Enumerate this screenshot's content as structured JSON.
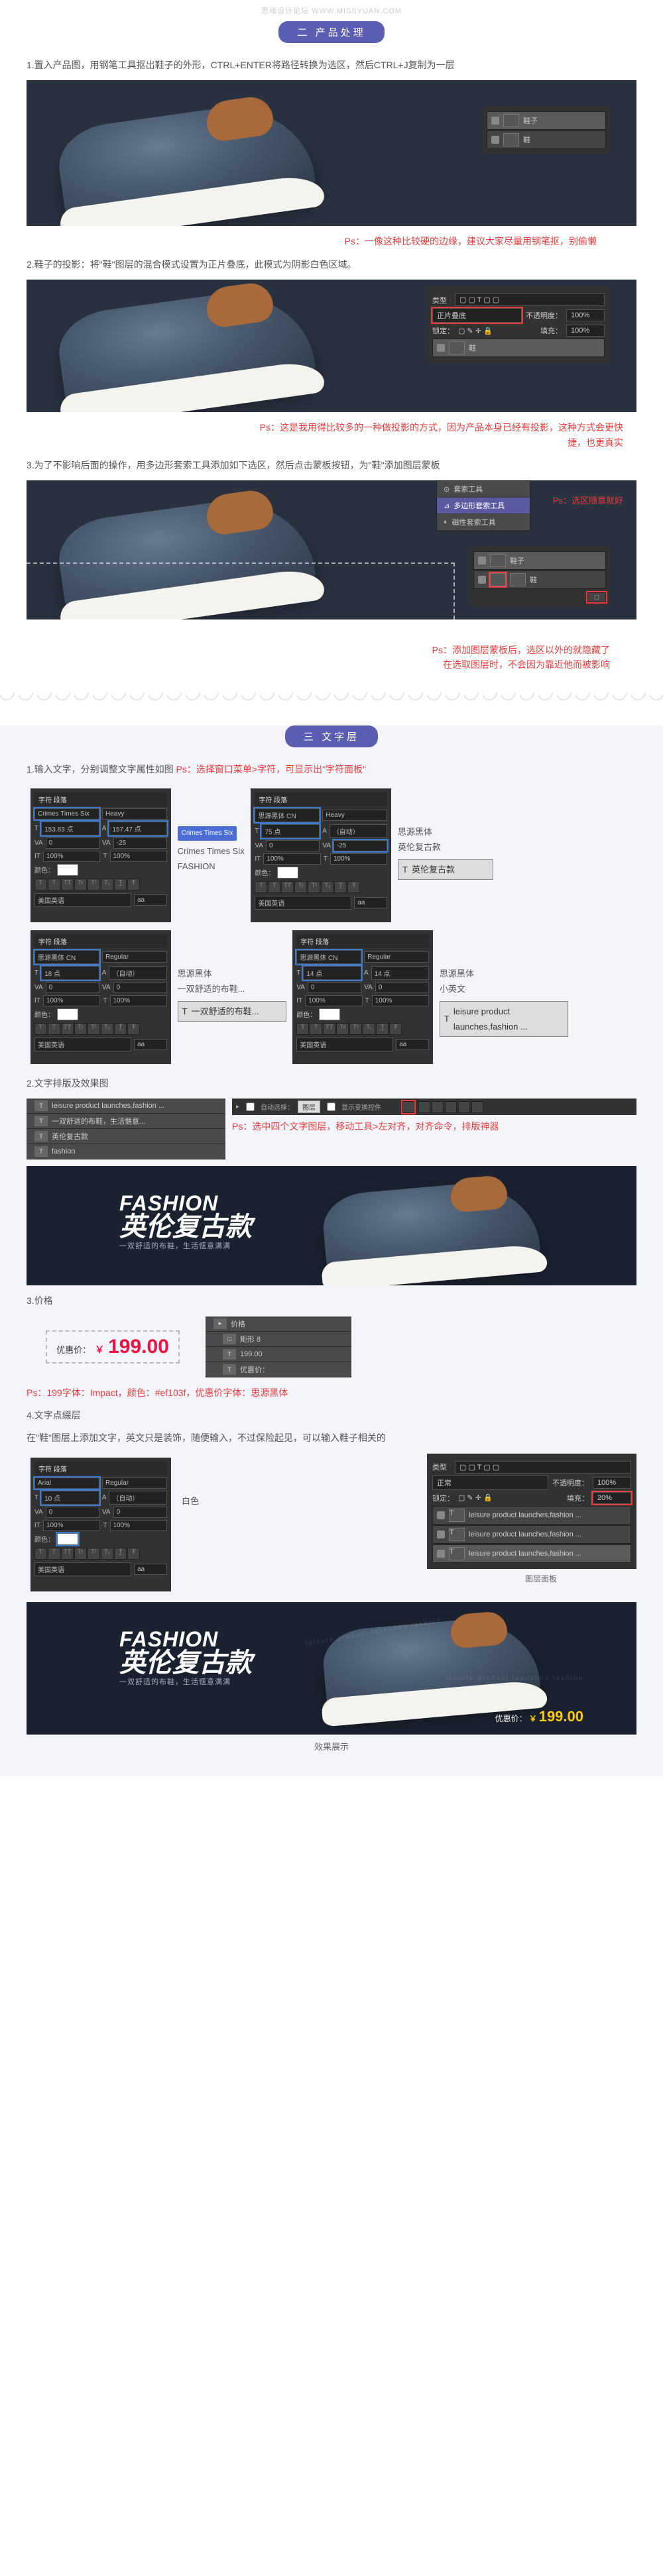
{
  "watermark": "思缘设计论坛  WWW.MISSYUAN.COM",
  "section2": {
    "title": "二 产品处理",
    "step1": "1.置入产品图，用钢笔工具抠出鞋子的外形，CTRL+ENTER将路径转换为选区，然后CTRL+J复制为一层",
    "step1_ps": "Ps：一像这种比较硬的边缘，建议大家尽量用钢笔抠，别偷懒",
    "layer_name": "鞋子",
    "step2": "2.鞋子的投影：将\"鞋\"图层的混合模式设置为正片叠底，此模式为阴影白色区域。",
    "blend": {
      "kind": "类型",
      "mode": "正片叠底",
      "opacity_label": "不透明度：",
      "opacity_val": "100%",
      "lock": "锁定：",
      "fill_label": "填充：",
      "fill_val": "100%",
      "layer": "鞋"
    },
    "step2_ps": "Ps：这是我用得比较多的一种做投影的方式，因为产品本身已经有投影，这种方式会更快捷，也更真实",
    "step3": "3.为了不影响后面的操作，用多边形套索工具添加如下选区，然后点击蒙板按钮，为\"鞋\"添加图层蒙板",
    "ctx_menu": {
      "i1": "套索工具",
      "i2": "多边形套索工具",
      "i3": "磁性套索工具"
    },
    "step3_ps1": "Ps：选区随意就好",
    "step3_ps2": "Ps：添加图层蒙板后，选区以外的就隐藏了\n在选取图层时，不会因为靠近他而被影响"
  },
  "section3": {
    "title": "三 文字层",
    "step1": "1.输入文字，分别调整文字属性如图",
    "step1_ps": "Ps：选择窗口菜单>字符，可显示出\"字符面板\"",
    "panel_tab": "字符  段落",
    "lang": "美国英语",
    "font1_name": "Crimes Times Six",
    "font1_style": "Heavy",
    "font1_size": "153.83 点",
    "font1_leading": "157.47 点",
    "font1_text": "Crimes Times Six\nFASHION",
    "font2_name": "思源黑体 CN",
    "font2_style": "Heavy",
    "font2_size": "75 点",
    "font2_leading": "-25",
    "font2_label": "思源黑体\n英伦复古款",
    "font2_layer": "英伦复古款",
    "font3_name": "思源黑体 CN",
    "font3_style": "Regular",
    "font3_size": "18 点",
    "font3_label": "思源黑体\n一双舒适的布鞋...",
    "font3_layer": "一双舒适的布鞋...",
    "font4_name": "思源黑体 CN",
    "font4_style": "Regular",
    "font4_size": "14 点",
    "font4_label": "思源黑体\n小英文",
    "font4_layer": "leisure product launches,fashion ...",
    "step2": "2.文字排版及效果图",
    "layers": {
      "l1": "leisure product launches,fashion ...",
      "l2": "一双舒适的布鞋，生活惬意...",
      "l3": "英伦复古款",
      "l4": "fashion"
    },
    "align": {
      "a": "自动选择：",
      "b": "图层",
      "c": "显示变换控件",
      "d": "左对齐"
    },
    "step2_ps": "Ps：选中四个文字图层，移动工具>左对齐，对齐命令，排版神器",
    "banner": {
      "fashion": "FASHION",
      "cn": "英伦复古款",
      "sub": "一双舒适的布鞋，生活惬意满满"
    },
    "step3": "3.价格",
    "price": {
      "label": "优惠价：",
      "cur": "￥",
      "num": "199.00"
    },
    "price_panel": {
      "l1": "优惠价：",
      "l2": "199.00"
    },
    "step3_ps": "Ps：199字体：Impact，颜色：#ef103f，优惠价字体：思源黑体",
    "step4": "4.文字点缀层",
    "step4_intro": "在\"鞋\"图层上添加文字，英文只是装饰，随便输入，不过保险起见，可以输入鞋子相关的",
    "arial": {
      "font": "Arial",
      "style": "Regular",
      "size": "10 点"
    },
    "white_label": "白色",
    "deco_layers": {
      "mode": "正常",
      "opacity_label": "不透明度：",
      "op": "100%",
      "fill_label": "填充：",
      "fill": "20%",
      "l1": "leisure product launches,fashion ...",
      "l2": "leisure product launches,fashion ...",
      "l3": "leisure product launches,fashion ..."
    },
    "panel_label": "图层面板",
    "final_title": "效果展示"
  }
}
